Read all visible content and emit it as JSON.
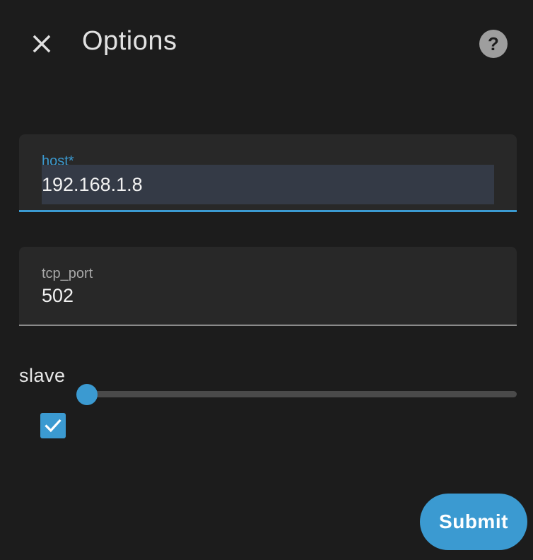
{
  "header": {
    "title": "Options",
    "close_icon": "close-icon",
    "help_icon": "help-circle-icon"
  },
  "form": {
    "host": {
      "label": "host*",
      "value": "192.168.1.8"
    },
    "tcp_port": {
      "label": "tcp_port",
      "value": "502"
    },
    "slave": {
      "label": "slave",
      "slider_value_fraction": 0.0
    },
    "checkbox": {
      "checked": true,
      "icon": "check-icon"
    }
  },
  "actions": {
    "submit_label": "Submit"
  },
  "colors": {
    "background": "#1c1c1c",
    "field_background": "#282828",
    "accent": "#3b9ad1",
    "text": "#e1e1e1"
  }
}
